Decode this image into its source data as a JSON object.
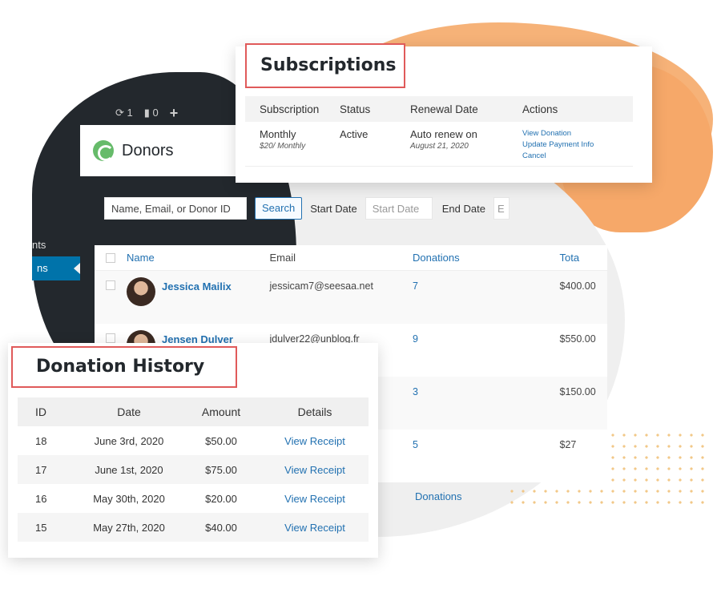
{
  "colors": {
    "accent": "#2271b1",
    "highlight_border": "#e05a5a",
    "decor_orange": "#f4a460",
    "admin_dark": "#23282d"
  },
  "admin_bar": {
    "updates_count": "1",
    "comments_count": "0",
    "add_icon": "plus-icon"
  },
  "sidebar": {
    "item_partial": "nts",
    "active_partial": "ns"
  },
  "donors": {
    "title": "Donors",
    "search_placeholder": "Name, Email, or Donor ID",
    "search_label": "Search",
    "start_date_label": "Start Date",
    "start_date_placeholder": "Start Date",
    "end_date_label": "End Date",
    "end_date_partial": "E",
    "columns": {
      "name": "Name",
      "email": "Email",
      "donations": "Donations",
      "total": "Tota"
    },
    "rows": [
      {
        "name": "Jessica Mailix",
        "email": "jessicam7@seesaa.net",
        "donations": "7",
        "total": "$400.00"
      },
      {
        "name": "Jensen Dulver",
        "email": "jdulver22@unblog.fr",
        "donations": "9",
        "total": "$550.00"
      },
      {
        "name": "",
        "email": "",
        "donations": "3",
        "total": "$150.00"
      },
      {
        "name": "",
        "email": "",
        "donations": "5",
        "total": "$27"
      }
    ],
    "footer_donations": "Donations"
  },
  "subscriptions": {
    "title": "Subscriptions",
    "columns": {
      "subscription": "Subscription",
      "status": "Status",
      "renewal": "Renewal Date",
      "actions": "Actions"
    },
    "row": {
      "plan": "Monthly",
      "plan_detail": "$20/ Monthly",
      "status": "Active",
      "renewal": "Auto renew on",
      "renewal_date": "August 21, 2020",
      "actions": [
        "View Donation",
        "Update Payment Info",
        "Cancel"
      ]
    }
  },
  "history": {
    "title": "Donation History",
    "columns": {
      "id": "ID",
      "date": "Date",
      "amount": "Amount",
      "details": "Details"
    },
    "rows": [
      {
        "id": "18",
        "date": "June 3rd, 2020",
        "amount": "$50.00",
        "details": "View Receipt"
      },
      {
        "id": "17",
        "date": "June 1st, 2020",
        "amount": "$75.00",
        "details": "View Receipt"
      },
      {
        "id": "16",
        "date": "May 30th, 2020",
        "amount": "$20.00",
        "details": "View Receipt"
      },
      {
        "id": "15",
        "date": "May 27th, 2020",
        "amount": "$40.00",
        "details": "View Receipt"
      }
    ]
  }
}
